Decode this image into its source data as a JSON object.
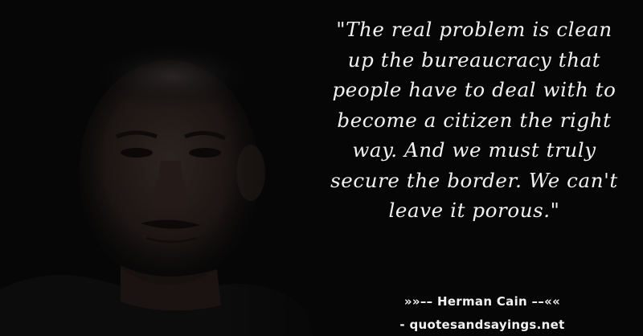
{
  "quote": {
    "text": "\"The real problem is clean up the bureaucracy that people have to deal with to become a citizen the right way. And we must truly secure the border. We can't leave it porous.\""
  },
  "attribution": {
    "author_line": "»»–– Herman Cain ––««",
    "website": "- quotesandsayings.net"
  },
  "colors": {
    "background": "#060606",
    "text": "#f2f2f2"
  }
}
